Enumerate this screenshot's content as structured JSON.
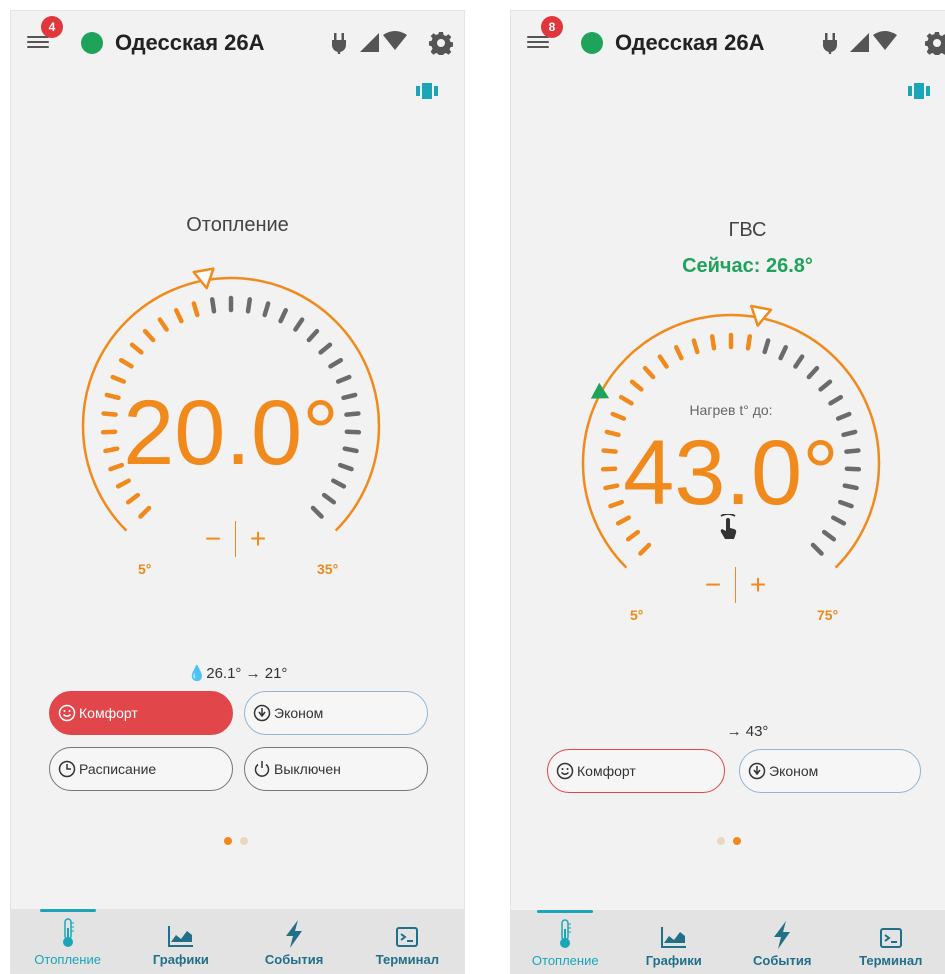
{
  "colors": {
    "accent_orange": "#f08a1c",
    "online_green": "#1fa35b",
    "comfort_red": "#e1464a",
    "nav_teal": "#1aa6b7",
    "nav_dark": "#226f88"
  },
  "left": {
    "header": {
      "badge": "4",
      "title": "Одесская 26А"
    },
    "mode_title": "Отопление",
    "dial": {
      "temperature": "20.0°",
      "min_label": "5°",
      "max_label": "35°",
      "minus": "−",
      "plus": "+"
    },
    "info": "💧26.1°  → 21°",
    "modes": [
      {
        "label": "Комфорт",
        "icon": "smile-icon",
        "active": true
      },
      {
        "label": "Эконом",
        "icon": "economy-icon",
        "active": false
      },
      {
        "label": "Расписание",
        "icon": "clock-icon",
        "active": false
      },
      {
        "label": "Выключен",
        "icon": "power-icon",
        "active": false
      }
    ],
    "pager_active": 0
  },
  "right": {
    "header": {
      "badge": "8",
      "title": "Одесская 26А"
    },
    "mode_title": "ГВС",
    "now": "Сейчас: 26.8°",
    "dial": {
      "heat_label": "Нагрев t° до:",
      "temperature": "43.0°",
      "min_label": "5°",
      "max_label": "75°",
      "minus": "−",
      "plus": "+"
    },
    "info": "→ 43°",
    "modes": [
      {
        "label": "Комфорт",
        "icon": "smile-icon",
        "active": false
      },
      {
        "label": "Эконом",
        "icon": "economy-icon",
        "active": false
      }
    ],
    "pager_active": 1
  },
  "bottom_nav": [
    {
      "label": "Отопление",
      "icon": "thermometer-icon",
      "active": true
    },
    {
      "label": "Графики",
      "icon": "chart-icon",
      "active": false
    },
    {
      "label": "События",
      "icon": "lightning-icon",
      "active": false
    },
    {
      "label": "Терминал",
      "icon": "terminal-icon",
      "active": false
    }
  ],
  "status_icons": [
    "power-plug-icon",
    "cell-signal-icon",
    "wifi-icon",
    "gear-icon"
  ]
}
